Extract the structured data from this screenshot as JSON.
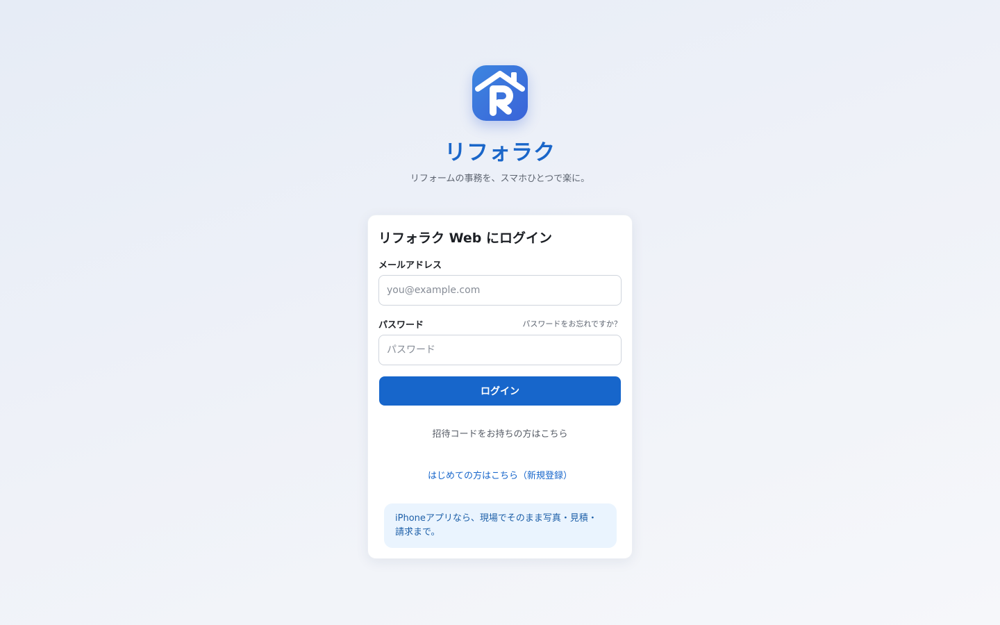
{
  "brand": {
    "app_name": "リフォラク",
    "tagline": "リフォームの事務を、スマホひとつで楽に。",
    "logo_icon": "house-r-logo-icon",
    "logo_gradient_start": "#3d86e0",
    "logo_gradient_end": "#3a63d8"
  },
  "login": {
    "title": "リフォラク Web にログイン",
    "email_label": "メールアドレス",
    "email_placeholder": "you@example.com",
    "email_value": "",
    "password_label": "パスワード",
    "password_placeholder": "パスワード",
    "password_value": "",
    "forgot_password": "パスワードをお忘れですか？",
    "submit_label": "ログイン",
    "invite_link": "招待コードをお持ちの方はこちら",
    "signup_link": "はじめての方はこちら（新規登録）",
    "promo_text": "iPhoneアプリなら、現場でそのまま写真・見積・請求まで。"
  },
  "colors": {
    "accent": "#1766cb",
    "promo_background": "#eaf4fe",
    "promo_text": "#1d5fa8"
  }
}
